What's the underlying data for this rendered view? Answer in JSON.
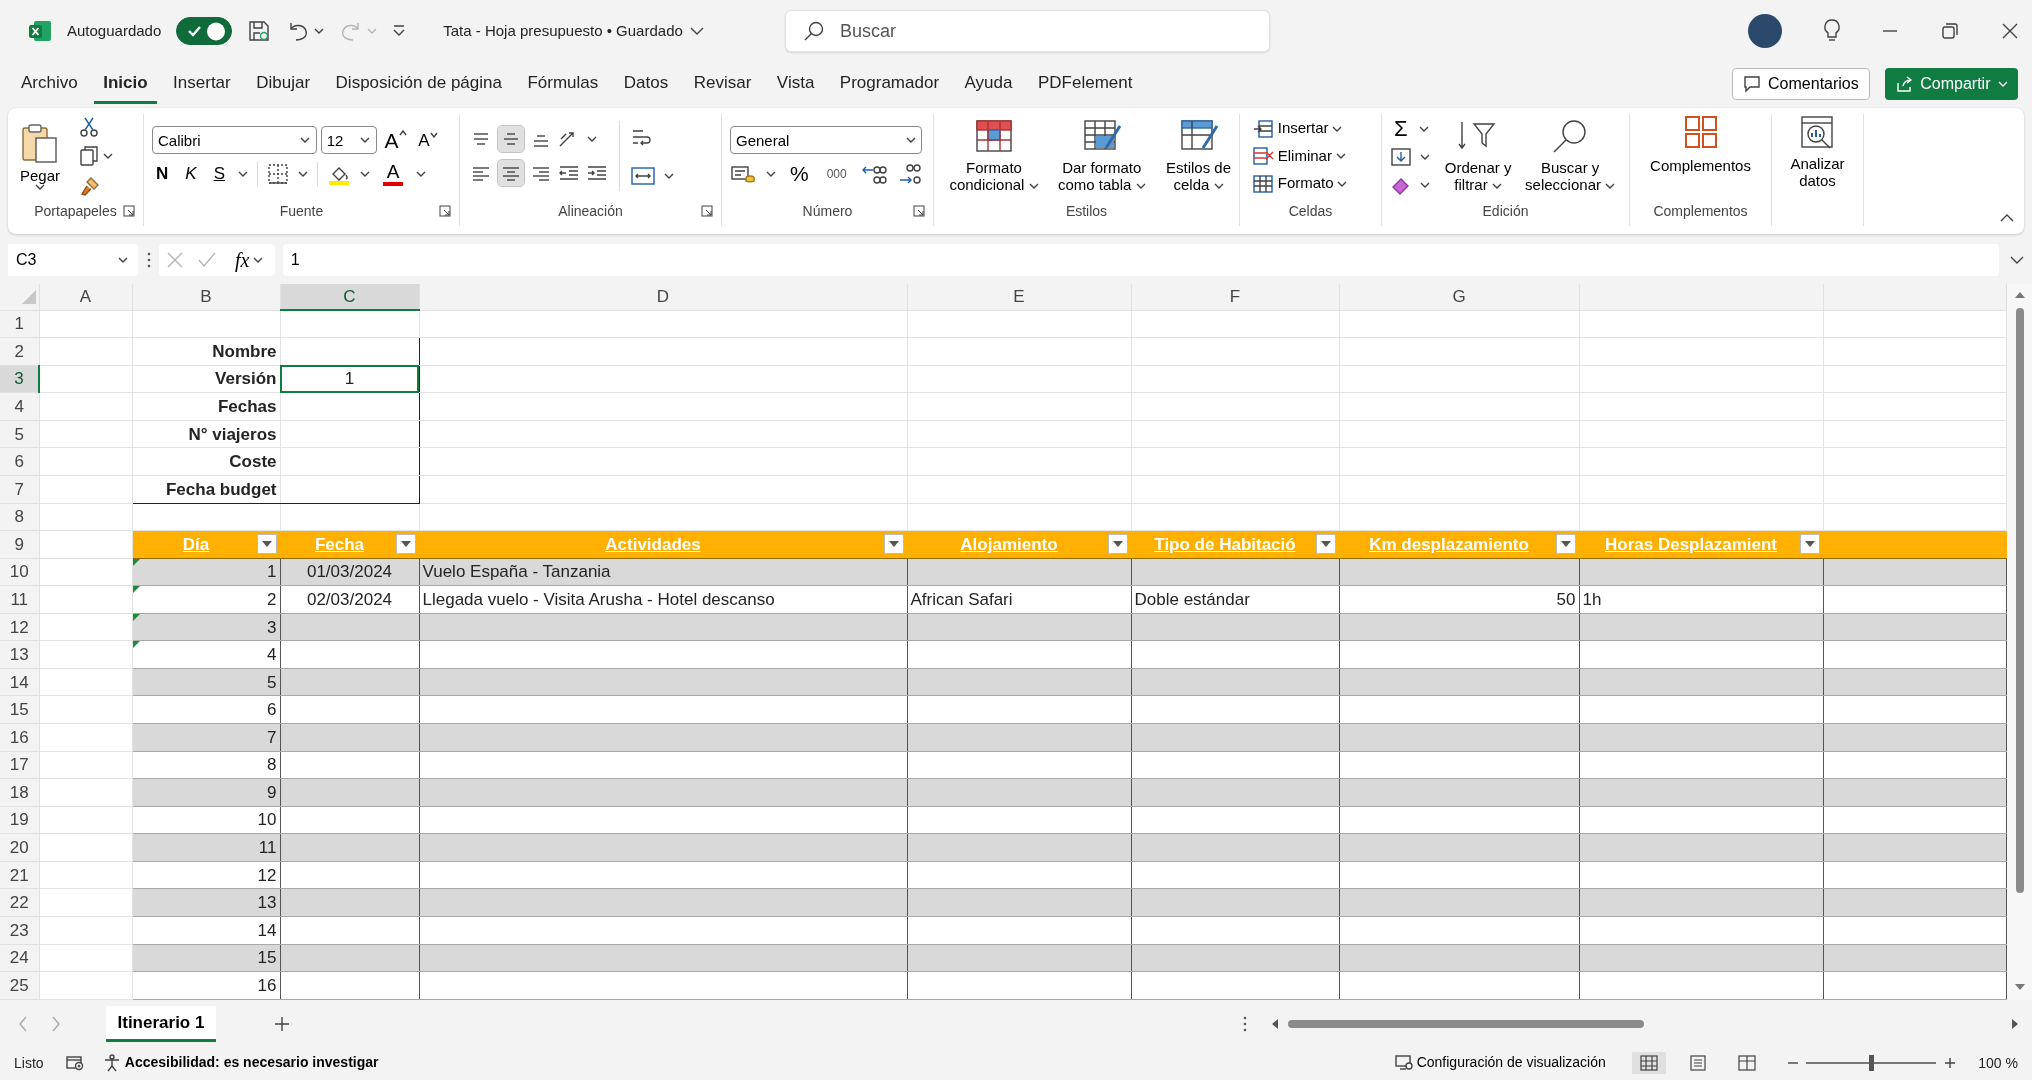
{
  "title_bar": {
    "autosave_label": "Autoguardado",
    "autosave_on": true,
    "redo_disabled": true,
    "document_title": "Tata - Hoja presupuesto • Guardado",
    "search": {
      "placeholder": "Buscar"
    }
  },
  "menu_tabs": [
    {
      "label": "Archivo",
      "selected": false
    },
    {
      "label": "Inicio",
      "selected": true
    },
    {
      "label": "Insertar",
      "selected": false
    },
    {
      "label": "Dibujar",
      "selected": false
    },
    {
      "label": "Disposición de página",
      "selected": false
    },
    {
      "label": "Fórmulas",
      "selected": false
    },
    {
      "label": "Datos",
      "selected": false
    },
    {
      "label": "Revisar",
      "selected": false
    },
    {
      "label": "Vista",
      "selected": false
    },
    {
      "label": "Programador",
      "selected": false
    },
    {
      "label": "Ayuda",
      "selected": false
    },
    {
      "label": "PDFelement",
      "selected": false
    }
  ],
  "comments_button": "Comentarios",
  "share_button": "Compartir",
  "ribbon": {
    "clipboard": {
      "paste": "Pegar",
      "label": "Portapapeles"
    },
    "font": {
      "name": "Calibri",
      "size": "12",
      "grow": "A",
      "shrink": "A",
      "bold": "N",
      "italic": "K",
      "underline": "S",
      "font_color": "A",
      "label": "Fuente"
    },
    "alignment": {
      "vertical": [
        {
          "selected": false
        },
        {
          "selected": true
        },
        {
          "selected": false
        }
      ],
      "horizontal": [
        {
          "selected": false
        },
        {
          "selected": true
        },
        {
          "selected": false
        }
      ],
      "label": "Alineación"
    },
    "number": {
      "format": "General",
      "percent": "%",
      "thousands": "000",
      "label": "Número"
    },
    "styles": {
      "buttons": [
        "Formato condicional",
        "Dar formato como tabla",
        "Estilos de celda"
      ],
      "label": "Estilos"
    },
    "cells": {
      "buttons": [
        "Insertar",
        "Eliminar",
        "Formato"
      ],
      "label": "Celdas"
    },
    "editing": {
      "sum": "Σ",
      "buttons": [
        "Ordenar y filtrar",
        "Buscar y seleccionar"
      ],
      "label": "Edición"
    },
    "addins": {
      "button": "Complementos",
      "label": "Complementos"
    },
    "analyze": {
      "button": "Analizar datos"
    }
  },
  "formula_bar": {
    "name_box": "C3",
    "function_label": "fx",
    "value": "1"
  },
  "columns": [
    {
      "letter": "A",
      "selected": false
    },
    {
      "letter": "B",
      "selected": false
    },
    {
      "letter": "C",
      "selected": true
    },
    {
      "letter": "D",
      "selected": false
    },
    {
      "letter": "E",
      "selected": false
    },
    {
      "letter": "F",
      "selected": false
    },
    {
      "letter": "G",
      "selected": false
    }
  ],
  "row_headers": [
    {
      "label": "1",
      "selected": false
    },
    {
      "label": "2",
      "selected": false
    },
    {
      "label": "3",
      "selected": true
    },
    {
      "label": "4",
      "selected": false
    },
    {
      "label": "5",
      "selected": false
    },
    {
      "label": "6",
      "selected": false
    },
    {
      "label": "7",
      "selected": false
    },
    {
      "label": "8",
      "selected": false
    },
    {
      "label": "9",
      "selected": false
    },
    {
      "label": "10",
      "selected": false
    },
    {
      "label": "11",
      "selected": false
    },
    {
      "label": "12",
      "selected": false
    },
    {
      "label": "13",
      "selected": false
    },
    {
      "label": "14",
      "selected": false
    },
    {
      "label": "15",
      "selected": false
    },
    {
      "label": "16",
      "selected": false
    },
    {
      "label": "17",
      "selected": false
    },
    {
      "label": "18",
      "selected": false
    },
    {
      "label": "19",
      "selected": false
    },
    {
      "label": "20",
      "selected": false
    },
    {
      "label": "21",
      "selected": false
    },
    {
      "label": "22",
      "selected": false
    },
    {
      "label": "23",
      "selected": false
    },
    {
      "label": "24",
      "selected": false
    },
    {
      "label": "25",
      "selected": false
    }
  ],
  "info_block": {
    "rows": [
      {
        "label": "Nombre",
        "selected": false
      },
      {
        "label": "Versión",
        "value": "1",
        "selected": true
      },
      {
        "label": "Fechas",
        "selected": false
      },
      {
        "label": "N° viajeros",
        "selected": false
      },
      {
        "label": "Coste",
        "selected": false
      },
      {
        "label": "Fecha budget",
        "selected": false
      }
    ]
  },
  "table": {
    "columns": [
      "Día",
      "Fecha",
      "Actividades",
      "Alojamiento",
      "Tipo de Habitació",
      "Km desplazamiento",
      "Horas Desplazamient"
    ],
    "rows": [
      {
        "day": "1",
        "date": "01/03/2024",
        "activities": "Vuelo España - Tanzania",
        "flag": true
      },
      {
        "day": "2",
        "date": "02/03/2024",
        "activities": "Llegada vuelo - Visita Arusha - Hotel descanso",
        "lodging": "African Safari",
        "room": "Doble estándar",
        "km": "50",
        "hours": "1h",
        "flag": true
      },
      {
        "day": "3",
        "flag": true
      },
      {
        "day": "4",
        "flag": true
      },
      {
        "day": "5",
        "flag": false
      },
      {
        "day": "6",
        "flag": false
      },
      {
        "day": "7",
        "flag": false
      },
      {
        "day": "8",
        "flag": false
      },
      {
        "day": "9",
        "flag": false
      },
      {
        "day": "10",
        "flag": false
      },
      {
        "day": "11",
        "flag": false
      },
      {
        "day": "12",
        "flag": false
      },
      {
        "day": "13",
        "flag": false
      },
      {
        "day": "14",
        "flag": false
      },
      {
        "day": "15",
        "flag": false
      },
      {
        "day": "16",
        "flag": false
      }
    ]
  },
  "sheet_tabs": [
    {
      "label": "Itinerario 1",
      "selected": true
    }
  ],
  "status_bar": {
    "status": "Listo",
    "accessibility": "Accesibilidad: es necesario investigar",
    "display_settings": "Configuración de visualización",
    "view_buttons": [
      {
        "selected": true
      },
      {
        "selected": false
      },
      {
        "selected": false
      }
    ],
    "zoom_slider": {
      "level": 0.5
    },
    "zoom": "100 %"
  }
}
